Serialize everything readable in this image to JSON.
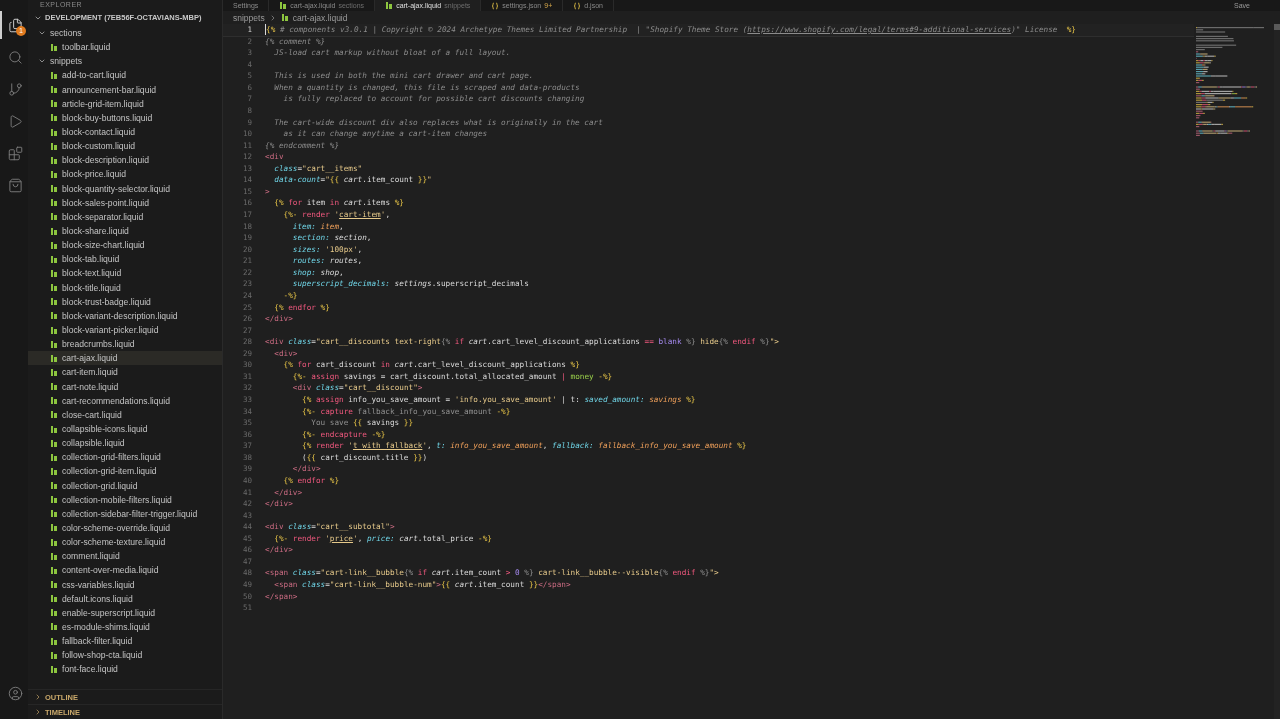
{
  "activity_bar": {
    "items": [
      {
        "kind": "files",
        "selected": true,
        "badge": "1"
      },
      {
        "kind": "search",
        "selected": false
      },
      {
        "kind": "source-control",
        "selected": false
      },
      {
        "kind": "run",
        "selected": false
      },
      {
        "kind": "extensions",
        "selected": false
      },
      {
        "kind": "shop",
        "selected": false
      }
    ],
    "bottom": [
      {
        "kind": "account",
        "selected": false
      }
    ]
  },
  "sidebar": {
    "title": "EXPLORER",
    "workspace": {
      "label": "DEVELOPMENT (7EB56F-OCTAVIANS-MBP)",
      "expanded": true
    },
    "tree": [
      {
        "label": "sections",
        "expanded": true,
        "children": [
          {
            "label": "toolbar.liquid",
            "selected": false
          }
        ]
      },
      {
        "label": "snippets",
        "expanded": true,
        "children": [
          {
            "label": "add-to-cart.liquid",
            "selected": false
          },
          {
            "label": "announcement-bar.liquid",
            "selected": false
          },
          {
            "label": "article-grid-item.liquid",
            "selected": false
          },
          {
            "label": "block-buy-buttons.liquid",
            "selected": false
          },
          {
            "label": "block-contact.liquid",
            "selected": false
          },
          {
            "label": "block-custom.liquid",
            "selected": false
          },
          {
            "label": "block-description.liquid",
            "selected": false
          },
          {
            "label": "block-price.liquid",
            "selected": false
          },
          {
            "label": "block-quantity-selector.liquid",
            "selected": false
          },
          {
            "label": "block-sales-point.liquid",
            "selected": false
          },
          {
            "label": "block-separator.liquid",
            "selected": false
          },
          {
            "label": "block-share.liquid",
            "selected": false
          },
          {
            "label": "block-size-chart.liquid",
            "selected": false
          },
          {
            "label": "block-tab.liquid",
            "selected": false
          },
          {
            "label": "block-text.liquid",
            "selected": false
          },
          {
            "label": "block-title.liquid",
            "selected": false
          },
          {
            "label": "block-trust-badge.liquid",
            "selected": false
          },
          {
            "label": "block-variant-description.liquid",
            "selected": false
          },
          {
            "label": "block-variant-picker.liquid",
            "selected": false
          },
          {
            "label": "breadcrumbs.liquid",
            "selected": false
          },
          {
            "label": "cart-ajax.liquid",
            "selected": true
          },
          {
            "label": "cart-item.liquid",
            "selected": false
          },
          {
            "label": "cart-note.liquid",
            "selected": false
          },
          {
            "label": "cart-recommendations.liquid",
            "selected": false
          },
          {
            "label": "close-cart.liquid",
            "selected": false
          },
          {
            "label": "collapsible-icons.liquid",
            "selected": false
          },
          {
            "label": "collapsible.liquid",
            "selected": false
          },
          {
            "label": "collection-grid-filters.liquid",
            "selected": false
          },
          {
            "label": "collection-grid-item.liquid",
            "selected": false
          },
          {
            "label": "collection-grid.liquid",
            "selected": false
          },
          {
            "label": "collection-mobile-filters.liquid",
            "selected": false
          },
          {
            "label": "collection-sidebar-filter-trigger.liquid",
            "selected": false
          },
          {
            "label": "color-scheme-override.liquid",
            "selected": false
          },
          {
            "label": "color-scheme-texture.liquid",
            "selected": false
          },
          {
            "label": "comment.liquid",
            "selected": false
          },
          {
            "label": "content-over-media.liquid",
            "selected": false
          },
          {
            "label": "css-variables.liquid",
            "selected": false
          },
          {
            "label": "default.icons.liquid",
            "selected": false
          },
          {
            "label": "enable-superscript.liquid",
            "selected": false
          },
          {
            "label": "es-module-shims.liquid",
            "selected": false
          },
          {
            "label": "fallback-filter.liquid",
            "selected": false
          },
          {
            "label": "follow-shop-cta.liquid",
            "selected": false
          },
          {
            "label": "font-face.liquid",
            "selected": false
          }
        ]
      }
    ],
    "panels": [
      {
        "label": "OUTLINE",
        "expanded": false
      },
      {
        "label": "TIMELINE",
        "expanded": false
      }
    ]
  },
  "editor": {
    "tabs": [
      {
        "kind": "settings",
        "label": "Settings",
        "selected": false
      },
      {
        "kind": "liquid",
        "label": "cart-ajax.liquid",
        "description": "sections",
        "selected": false
      },
      {
        "kind": "liquid",
        "label": "cart-ajax.liquid",
        "description": "snippets",
        "selected": true
      },
      {
        "kind": "json",
        "label": "settings.json",
        "description": "9+",
        "selected": false
      },
      {
        "kind": "json",
        "label": "d.json",
        "selected": false
      }
    ],
    "action": "Save",
    "breadcrumbs": [
      "snippets",
      "cart-ajax.liquid"
    ],
    "lines": [
      {
        "number": "1",
        "current": true,
        "tokens": [
          {
            "kind": "delim",
            "text": "{%"
          },
          {
            "kind": "comment",
            "text": " # components v3.0.1 | Copyright © 2024 Archetype Themes Limited Partnership  | \"Shopify Theme Store ("
          },
          {
            "kind": "comment_link",
            "text": "https://www.shopify.com/legal/terms#9-additional-services"
          },
          {
            "kind": "comment",
            "text": ")\" License  "
          },
          {
            "kind": "delim",
            "text": "%}"
          }
        ]
      },
      {
        "number": "2",
        "current": false,
        "tokens": [
          {
            "kind": "comment",
            "text": "{% comment %}"
          }
        ]
      },
      {
        "number": "3",
        "current": false,
        "tokens": [
          {
            "kind": "comment",
            "text": "  JS-load cart markup without bloat of a full layout."
          }
        ]
      },
      {
        "number": "4",
        "current": false
      },
      {
        "number": "5",
        "current": false,
        "tokens": [
          {
            "kind": "comment",
            "text": "  This is used in both the mini cart drawer and cart page."
          }
        ]
      },
      {
        "number": "6",
        "current": false,
        "tokens": [
          {
            "kind": "comment",
            "text": "  When a quantity is changed, this file is scraped and data-products"
          }
        ]
      },
      {
        "number": "7",
        "current": false,
        "tokens": [
          {
            "kind": "comment",
            "text": "    is fully replaced to account for possible cart discounts changing"
          }
        ]
      },
      {
        "number": "8",
        "current": false
      },
      {
        "number": "9",
        "current": false,
        "tokens": [
          {
            "kind": "comment",
            "text": "  The cart-wide discount div also replaces what is originally in the cart"
          }
        ]
      },
      {
        "number": "10",
        "current": false,
        "tokens": [
          {
            "kind": "comment",
            "text": "    as it can change anytime a cart-item changes"
          }
        ]
      },
      {
        "number": "11",
        "current": false,
        "tokens": [
          {
            "kind": "comment",
            "text": "{% endcomment %}"
          }
        ]
      },
      {
        "number": "12",
        "current": false,
        "tokens": [
          {
            "kind": "tag",
            "text": "<div"
          }
        ]
      },
      {
        "number": "13",
        "current": false,
        "tokens": [
          {
            "kind": "attr",
            "text": "  class"
          },
          {
            "kind": "plain",
            "text": "="
          },
          {
            "kind": "string",
            "text": "\"cart__items\""
          }
        ]
      },
      {
        "number": "14",
        "current": false,
        "tokens": [
          {
            "kind": "attr",
            "text": "  data-count"
          },
          {
            "kind": "plain",
            "text": "="
          },
          {
            "kind": "string",
            "text": "\""
          },
          {
            "kind": "delim",
            "text": "{{"
          },
          {
            "kind": "object",
            "text": " cart"
          },
          {
            "kind": "plain",
            "text": ".item_count "
          },
          {
            "kind": "delim",
            "text": "}}"
          },
          {
            "kind": "string",
            "text": "\""
          }
        ]
      },
      {
        "number": "15",
        "current": false,
        "tokens": [
          {
            "kind": "tag",
            "text": ">"
          }
        ]
      },
      {
        "number": "16",
        "current": false,
        "tokens": [
          {
            "kind": "delim",
            "text": "  {%"
          },
          {
            "kind": "keyword",
            "text": " for"
          },
          {
            "kind": "plain",
            "text": " item"
          },
          {
            "kind": "keyword",
            "text": " in"
          },
          {
            "kind": "object",
            "text": " cart"
          },
          {
            "kind": "plain",
            "text": ".items "
          },
          {
            "kind": "delim",
            "text": "%}"
          }
        ]
      },
      {
        "number": "17",
        "current": false,
        "tokens": [
          {
            "kind": "delim",
            "text": "    {%-"
          },
          {
            "kind": "keyword",
            "text": " render"
          },
          {
            "kind": "string",
            "text": " '"
          },
          {
            "kind": "string_link",
            "text": "cart-item"
          },
          {
            "kind": "string",
            "text": "'"
          },
          {
            "kind": "plain",
            "text": ","
          }
        ]
      },
      {
        "number": "18",
        "current": false,
        "tokens": [
          {
            "kind": "attr",
            "text": "      item:"
          },
          {
            "kind": "value",
            "text": " item"
          },
          {
            "kind": "plain",
            "text": ","
          }
        ]
      },
      {
        "number": "19",
        "current": false,
        "tokens": [
          {
            "kind": "attr",
            "text": "      section:"
          },
          {
            "kind": "object",
            "text": " section"
          },
          {
            "kind": "plain",
            "text": ","
          }
        ]
      },
      {
        "number": "20",
        "current": false,
        "tokens": [
          {
            "kind": "attr",
            "text": "      sizes:"
          },
          {
            "kind": "string",
            "text": " '100px'"
          },
          {
            "kind": "plain",
            "text": ","
          }
        ]
      },
      {
        "number": "21",
        "current": false,
        "tokens": [
          {
            "kind": "attr",
            "text": "      routes:"
          },
          {
            "kind": "object",
            "text": " routes"
          },
          {
            "kind": "plain",
            "text": ","
          }
        ]
      },
      {
        "number": "22",
        "current": false,
        "tokens": [
          {
            "kind": "attr",
            "text": "      shop:"
          },
          {
            "kind": "object",
            "text": " shop"
          },
          {
            "kind": "plain",
            "text": ","
          }
        ]
      },
      {
        "number": "23",
        "current": false,
        "tokens": [
          {
            "kind": "attr",
            "text": "      superscript_decimals:"
          },
          {
            "kind": "object",
            "text": " settings"
          },
          {
            "kind": "plain",
            "text": ".superscript_decimals"
          }
        ]
      },
      {
        "number": "24",
        "current": false,
        "tokens": [
          {
            "kind": "delim",
            "text": "    -%}"
          }
        ]
      },
      {
        "number": "25",
        "current": false,
        "tokens": [
          {
            "kind": "delim",
            "text": "  {%"
          },
          {
            "kind": "keyword",
            "text": " endfor"
          },
          {
            "kind": "delim",
            "text": " %}"
          }
        ]
      },
      {
        "number": "26",
        "current": false,
        "tokens": [
          {
            "kind": "tag",
            "text": "</div>"
          }
        ]
      },
      {
        "number": "27",
        "current": false
      },
      {
        "number": "28",
        "current": false,
        "tokens": [
          {
            "kind": "tag",
            "text": "<div"
          },
          {
            "kind": "attr",
            "text": " class"
          },
          {
            "kind": "plain",
            "text": "="
          },
          {
            "kind": "string",
            "text": "\"cart__discounts text-right"
          },
          {
            "kind": "dim",
            "text": "{%"
          },
          {
            "kind": "keyword",
            "text": " if"
          },
          {
            "kind": "object",
            "text": " cart"
          },
          {
            "kind": "plain",
            "text": ".cart_level_discount_applications "
          },
          {
            "kind": "keyword",
            "text": "=="
          },
          {
            "kind": "number",
            "text": " blank"
          },
          {
            "kind": "dim",
            "text": " %}"
          },
          {
            "kind": "string",
            "text": " hide"
          },
          {
            "kind": "dim",
            "text": "{%"
          },
          {
            "kind": "keyword",
            "text": " endif"
          },
          {
            "kind": "dim",
            "text": " %}"
          },
          {
            "kind": "string",
            "text": "\">"
          }
        ]
      },
      {
        "number": "29",
        "current": false,
        "tokens": [
          {
            "kind": "tag",
            "text": "  <div>"
          }
        ]
      },
      {
        "number": "30",
        "current": false,
        "tokens": [
          {
            "kind": "delim",
            "text": "    {%"
          },
          {
            "kind": "keyword",
            "text": " for"
          },
          {
            "kind": "plain",
            "text": " cart_discount"
          },
          {
            "kind": "keyword",
            "text": " in"
          },
          {
            "kind": "object",
            "text": " cart"
          },
          {
            "kind": "plain",
            "text": ".cart_level_discount_applications "
          },
          {
            "kind": "delim",
            "text": "%}"
          }
        ]
      },
      {
        "number": "31",
        "current": false,
        "tokens": [
          {
            "kind": "delim",
            "text": "      {%-"
          },
          {
            "kind": "keyword",
            "text": " assign"
          },
          {
            "kind": "plain",
            "text": " savings = cart_discount.total_allocated_amount "
          },
          {
            "kind": "keyword",
            "text": "|"
          },
          {
            "kind": "filter",
            "text": " money"
          },
          {
            "kind": "delim",
            "text": " -%}"
          }
        ]
      },
      {
        "number": "32",
        "current": false,
        "tokens": [
          {
            "kind": "tag",
            "text": "      <div"
          },
          {
            "kind": "attr",
            "text": " class"
          },
          {
            "kind": "plain",
            "text": "="
          },
          {
            "kind": "string",
            "text": "\"cart__discount\""
          },
          {
            "kind": "tag",
            "text": ">"
          }
        ]
      },
      {
        "number": "33",
        "current": false,
        "tokens": [
          {
            "kind": "delim",
            "text": "        {%"
          },
          {
            "kind": "keyword",
            "text": " assign"
          },
          {
            "kind": "plain",
            "text": " info_you_save_amount = "
          },
          {
            "kind": "string",
            "text": "'info.you_save_amount'"
          },
          {
            "kind": "plain",
            "text": " | t: "
          },
          {
            "kind": "attr",
            "text": "saved_amount:"
          },
          {
            "kind": "value",
            "text": " savings"
          },
          {
            "kind": "delim",
            "text": " %}"
          }
        ]
      },
      {
        "number": "34",
        "current": false,
        "tokens": [
          {
            "kind": "delim",
            "text": "        {%-"
          },
          {
            "kind": "keyword",
            "text": " capture"
          },
          {
            "kind": "dim",
            "text": " fallback_info_you_save_amount"
          },
          {
            "kind": "delim",
            "text": " -%}"
          }
        ]
      },
      {
        "number": "35",
        "current": false,
        "tokens": [
          {
            "kind": "dim",
            "text": "          You save "
          },
          {
            "kind": "delim",
            "text": "{{"
          },
          {
            "kind": "plain",
            "text": " savings "
          },
          {
            "kind": "delim",
            "text": "}}"
          }
        ]
      },
      {
        "number": "36",
        "current": false,
        "tokens": [
          {
            "kind": "delim",
            "text": "        {%-"
          },
          {
            "kind": "keyword",
            "text": " endcapture"
          },
          {
            "kind": "delim",
            "text": " -%}"
          }
        ]
      },
      {
        "number": "37",
        "current": false,
        "tokens": [
          {
            "kind": "delim",
            "text": "        {%"
          },
          {
            "kind": "keyword",
            "text": " render"
          },
          {
            "kind": "string",
            "text": " '"
          },
          {
            "kind": "string_link",
            "text": "t_with_fallback"
          },
          {
            "kind": "string",
            "text": "'"
          },
          {
            "kind": "plain",
            "text": ", "
          },
          {
            "kind": "attr",
            "text": "t:"
          },
          {
            "kind": "value",
            "text": " info_you_save_amount"
          },
          {
            "kind": "plain",
            "text": ", "
          },
          {
            "kind": "attr",
            "text": "fallback:"
          },
          {
            "kind": "value",
            "text": " fallback_info_you_save_amount"
          },
          {
            "kind": "delim",
            "text": " %}"
          }
        ]
      },
      {
        "number": "38",
        "current": false,
        "tokens": [
          {
            "kind": "plain",
            "text": "        ("
          },
          {
            "kind": "delim",
            "text": "{{"
          },
          {
            "kind": "plain",
            "text": " cart_discount.title "
          },
          {
            "kind": "delim",
            "text": "}}"
          },
          {
            "kind": "plain",
            "text": ")"
          }
        ]
      },
      {
        "number": "39",
        "current": false,
        "tokens": [
          {
            "kind": "tag",
            "text": "      </div>"
          }
        ]
      },
      {
        "number": "40",
        "current": false,
        "tokens": [
          {
            "kind": "delim",
            "text": "    {%"
          },
          {
            "kind": "keyword",
            "text": " endfor"
          },
          {
            "kind": "delim",
            "text": " %}"
          }
        ]
      },
      {
        "number": "41",
        "current": false,
        "tokens": [
          {
            "kind": "tag",
            "text": "  </div>"
          }
        ]
      },
      {
        "number": "42",
        "current": false,
        "tokens": [
          {
            "kind": "tag",
            "text": "</div>"
          }
        ]
      },
      {
        "number": "43",
        "current": false
      },
      {
        "number": "44",
        "current": false,
        "tokens": [
          {
            "kind": "tag",
            "text": "<div"
          },
          {
            "kind": "attr",
            "text": " class"
          },
          {
            "kind": "plain",
            "text": "="
          },
          {
            "kind": "string",
            "text": "\"cart__subtotal\""
          },
          {
            "kind": "tag",
            "text": ">"
          }
        ]
      },
      {
        "number": "45",
        "current": false,
        "tokens": [
          {
            "kind": "delim",
            "text": "  {%-"
          },
          {
            "kind": "keyword",
            "text": " render"
          },
          {
            "kind": "string",
            "text": " '"
          },
          {
            "kind": "string_link",
            "text": "price"
          },
          {
            "kind": "string",
            "text": "'"
          },
          {
            "kind": "plain",
            "text": ", "
          },
          {
            "kind": "attr",
            "text": "price:"
          },
          {
            "kind": "object",
            "text": " cart"
          },
          {
            "kind": "plain",
            "text": ".total_price "
          },
          {
            "kind": "delim",
            "text": "-%}"
          }
        ]
      },
      {
        "number": "46",
        "current": false,
        "tokens": [
          {
            "kind": "tag",
            "text": "</div>"
          }
        ]
      },
      {
        "number": "47",
        "current": false
      },
      {
        "number": "48",
        "current": false,
        "tokens": [
          {
            "kind": "tag",
            "text": "<span"
          },
          {
            "kind": "attr",
            "text": " class"
          },
          {
            "kind": "plain",
            "text": "="
          },
          {
            "kind": "string",
            "text": "\"cart-link__bubble"
          },
          {
            "kind": "dim",
            "text": "{%"
          },
          {
            "kind": "keyword",
            "text": " if"
          },
          {
            "kind": "object",
            "text": " cart"
          },
          {
            "kind": "plain",
            "text": ".item_count "
          },
          {
            "kind": "keyword",
            "text": ">"
          },
          {
            "kind": "number",
            "text": " 0"
          },
          {
            "kind": "dim",
            "text": " %}"
          },
          {
            "kind": "string",
            "text": " cart-link__bubble--visible"
          },
          {
            "kind": "dim",
            "text": "{%"
          },
          {
            "kind": "keyword",
            "text": " endif"
          },
          {
            "kind": "dim",
            "text": " %}"
          },
          {
            "kind": "string",
            "text": "\">"
          }
        ]
      },
      {
        "number": "49",
        "current": false,
        "tokens": [
          {
            "kind": "tag",
            "text": "  <span"
          },
          {
            "kind": "attr",
            "text": " class"
          },
          {
            "kind": "plain",
            "text": "="
          },
          {
            "kind": "string",
            "text": "\"cart-link__bubble-num\""
          },
          {
            "kind": "tag",
            "text": ">"
          },
          {
            "kind": "delim",
            "text": "{{"
          },
          {
            "kind": "object",
            "text": " cart"
          },
          {
            "kind": "plain",
            "text": ".item_count "
          },
          {
            "kind": "delim",
            "text": "}}"
          },
          {
            "kind": "tag",
            "text": "</span>"
          }
        ]
      },
      {
        "number": "50",
        "current": false,
        "tokens": [
          {
            "kind": "tag",
            "text": "</span>"
          }
        ]
      },
      {
        "number": "51",
        "current": false
      }
    ]
  }
}
